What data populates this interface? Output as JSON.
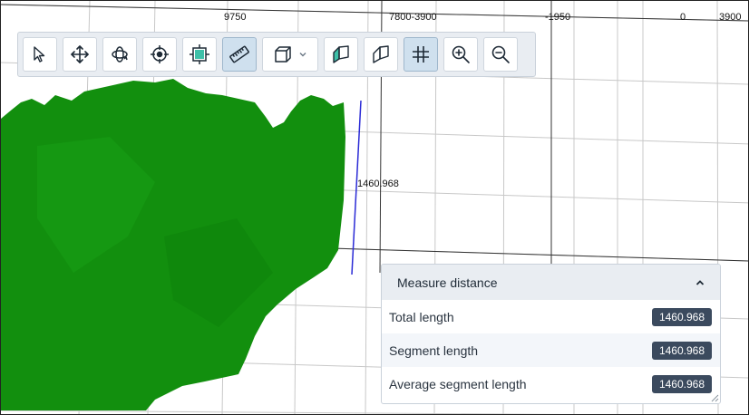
{
  "axis_labels": {
    "top_left": "9750",
    "top_middle": "7800-3900",
    "top_right_overlap": "-1950",
    "top_zero": "0",
    "top_right": "3900"
  },
  "measurement_label": "1460.968",
  "toolbar": {
    "tools": [
      {
        "name": "select-tool",
        "icon": "pointer-arrow-icon",
        "active": false
      },
      {
        "name": "pan-tool",
        "icon": "move-arrows-icon",
        "active": false
      },
      {
        "name": "orbit-tool",
        "icon": "orbit-icon",
        "active": false
      },
      {
        "name": "focus-tool",
        "icon": "crosshair-icon",
        "active": false
      },
      {
        "name": "fit-view-tool",
        "icon": "fit-frame-icon",
        "active": false
      },
      {
        "name": "measure-tool",
        "icon": "ruler-icon",
        "active": true
      },
      {
        "name": "view-cube-dropdown",
        "icon": "cube-icon",
        "active": false
      },
      {
        "name": "section-plane-filled",
        "icon": "section-plane-filled-icon",
        "active": false
      },
      {
        "name": "section-plane-outline",
        "icon": "section-plane-outline-icon",
        "active": false
      },
      {
        "name": "grid-toggle",
        "icon": "grid-icon",
        "active": true
      },
      {
        "name": "zoom-in",
        "icon": "zoom-in-icon",
        "active": false
      },
      {
        "name": "zoom-out",
        "icon": "zoom-out-icon",
        "active": false
      }
    ]
  },
  "measure_panel": {
    "title": "Measure distance",
    "rows": [
      {
        "label": "Total length",
        "value": "1460.968"
      },
      {
        "label": "Segment length",
        "value": "1460.968"
      },
      {
        "label": "Average segment length",
        "value": "1460.968"
      }
    ]
  },
  "colors": {
    "terrain": "#128f0e",
    "measure_line": "#2b2bd6",
    "toolbar_bg": "#e9edf2",
    "badge_bg": "#3b4a5e"
  }
}
